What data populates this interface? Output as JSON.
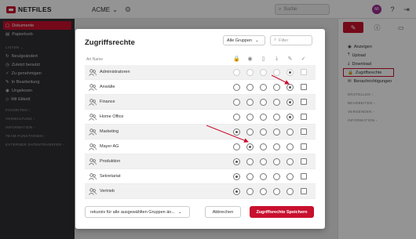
{
  "app": {
    "logo_text": "NETFILES",
    "tenant": "ACME",
    "search_placeholder": "Suche",
    "avatar_initials": "MI"
  },
  "sidebar": {
    "items": [
      {
        "label": "Dokumente",
        "icon": "folder-icon",
        "active": true
      },
      {
        "label": "Papierkorb",
        "icon": "trash-icon"
      }
    ],
    "lists_section": "LISTEN",
    "list_items": [
      {
        "label": "Neu/geändert",
        "icon": "sync-icon"
      },
      {
        "label": "Zuletzt benutzt",
        "icon": "clock-icon"
      },
      {
        "label": "Zu genehmigen",
        "icon": "check-icon"
      },
      {
        "label": "In Bearbeitung",
        "icon": "edit-icon"
      },
      {
        "label": "Ungelesen",
        "icon": "eye-icon"
      },
      {
        "label": "Mit Etikett",
        "icon": "tag-icon"
      }
    ],
    "sections": [
      "FAVORITEN",
      "VERWALTUNG",
      "INFORMATION",
      "TEAM-FUNKTIONEN",
      "EXTERNER DATENTRANSFER"
    ]
  },
  "breadcrumb": {
    "label": "Dokumente"
  },
  "right_panel": {
    "items": [
      {
        "label": "Anzeigen",
        "icon": "eye-icon"
      },
      {
        "label": "Upload",
        "icon": "upload-icon"
      },
      {
        "label": "Download",
        "icon": "download-icon"
      },
      {
        "label": "Zugriffsrechte",
        "icon": "lock-icon",
        "highlight": true
      },
      {
        "label": "Benachrichtigungen",
        "icon": "mail-icon"
      }
    ],
    "sections": [
      "ERSTELLEN",
      "BEARBEITEN",
      "VERSENDEN",
      "INFORMATION"
    ]
  },
  "dialog": {
    "title": "Zugriffsrechte",
    "group_filter": "Alle Gruppen",
    "filter_placeholder": "Filter",
    "column_label": "Art  Name",
    "perm_icons": [
      "lock-icon",
      "eye-icon",
      "file-icon",
      "download-icon",
      "pencil-icon",
      "check-icon"
    ],
    "rows": [
      {
        "name": "Administratoren",
        "checked": 4,
        "dim": true
      },
      {
        "name": "Anwälte",
        "checked": 4
      },
      {
        "name": "Finance",
        "checked": 4
      },
      {
        "name": "Home Office",
        "checked": 4
      },
      {
        "name": "Marketing",
        "checked": 0
      },
      {
        "name": "Mayer AG",
        "checked": 1
      },
      {
        "name": "Produktion",
        "checked": 0
      },
      {
        "name": "Sekretariat",
        "checked": 0
      },
      {
        "name": "Vertrieb",
        "checked": 0
      }
    ],
    "recursive_label": "rekursiv für alle ausgewählten Gruppen än...",
    "cancel_label": "Abbrechen",
    "save_label": "Zugriffsrechte Speichern"
  },
  "colors": {
    "accent": "#c8102e",
    "sidebar": "#2f3033"
  }
}
